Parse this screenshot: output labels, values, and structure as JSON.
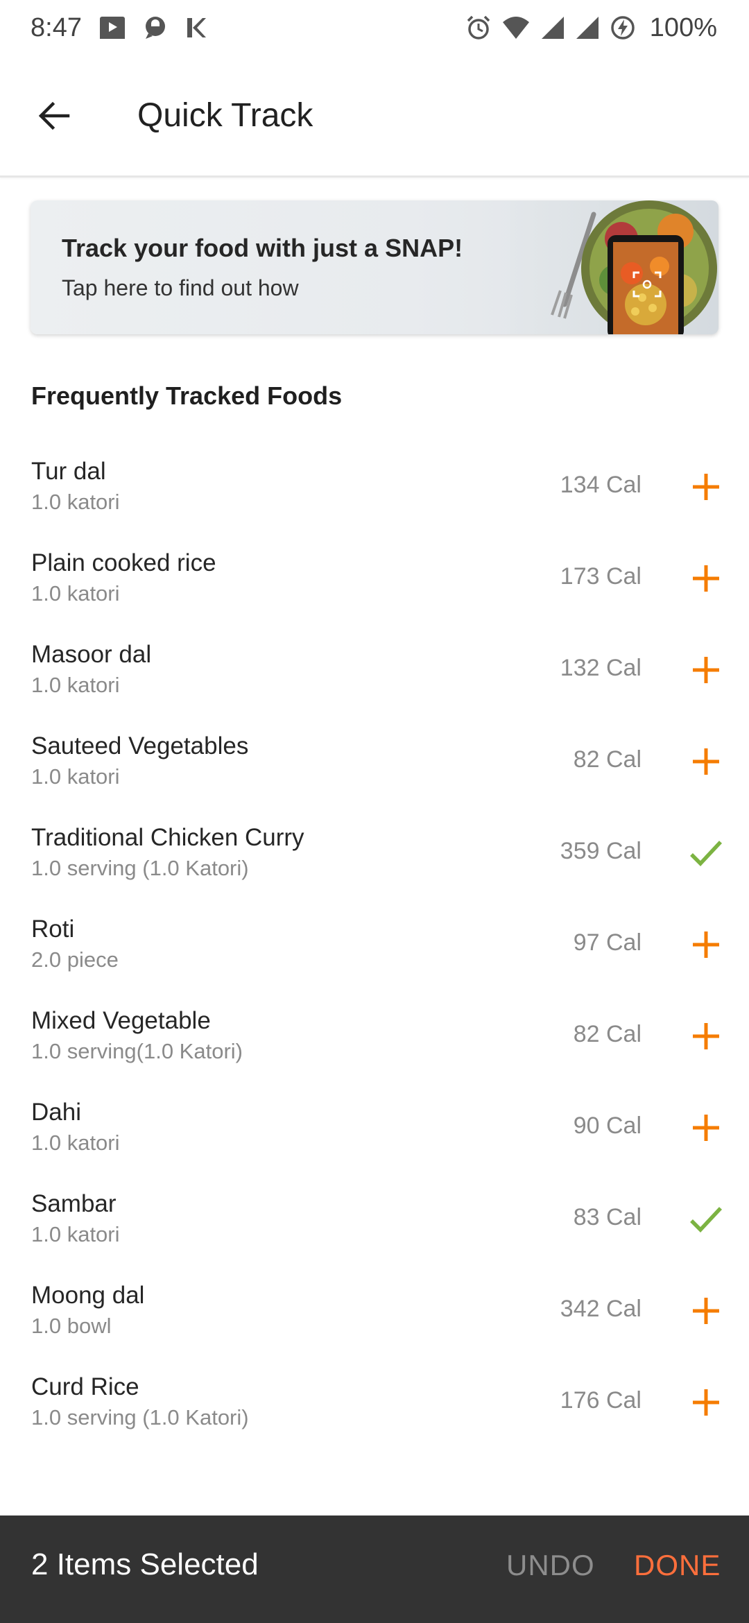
{
  "status_bar": {
    "time": "8:47",
    "battery": "100%",
    "icons": [
      "media-icon",
      "vpn-icon",
      "k-icon",
      "alarm-icon",
      "wifi-icon",
      "signal-icon",
      "signal-icon",
      "battery-saver-icon"
    ]
  },
  "app_bar": {
    "title": "Quick Track",
    "back_icon": "arrow-left-icon"
  },
  "banner": {
    "title": "Track your food with just a SNAP!",
    "subtitle": "Tap here to find out how"
  },
  "section": {
    "title": "Frequently Tracked Foods"
  },
  "foods": [
    {
      "name": "Tur dal",
      "qty": "1.0 katori",
      "cal": "134 Cal",
      "selected": false
    },
    {
      "name": "Plain cooked rice",
      "qty": "1.0 katori",
      "cal": "173 Cal",
      "selected": false
    },
    {
      "name": "Masoor dal",
      "qty": "1.0 katori",
      "cal": "132 Cal",
      "selected": false
    },
    {
      "name": "Sauteed Vegetables",
      "qty": "1.0 katori",
      "cal": "82 Cal",
      "selected": false
    },
    {
      "name": "Traditional Chicken Curry",
      "qty": "1.0 serving (1.0 Katori)",
      "cal": "359 Cal",
      "selected": true
    },
    {
      "name": "Roti",
      "qty": "2.0 piece",
      "cal": "97 Cal",
      "selected": false
    },
    {
      "name": "Mixed Vegetable",
      "qty": "1.0 serving(1.0 Katori)",
      "cal": "82 Cal",
      "selected": false
    },
    {
      "name": "Dahi",
      "qty": "1.0 katori",
      "cal": "90 Cal",
      "selected": false
    },
    {
      "name": "Sambar",
      "qty": "1.0 katori",
      "cal": "83 Cal",
      "selected": true
    },
    {
      "name": "Moong dal",
      "qty": "1.0 bowl",
      "cal": "342 Cal",
      "selected": false
    },
    {
      "name": "Curd Rice",
      "qty": "1.0 serving (1.0 Katori)",
      "cal": "176 Cal",
      "selected": false
    }
  ],
  "bottom_bar": {
    "selected_text": "2 Items Selected",
    "undo_label": "UNDO",
    "done_label": "DONE"
  },
  "colors": {
    "accent_orange": "#f57c00",
    "check_green": "#7cb342",
    "done_orange": "#ff6f3c",
    "bottom_bar_bg": "#333333"
  }
}
